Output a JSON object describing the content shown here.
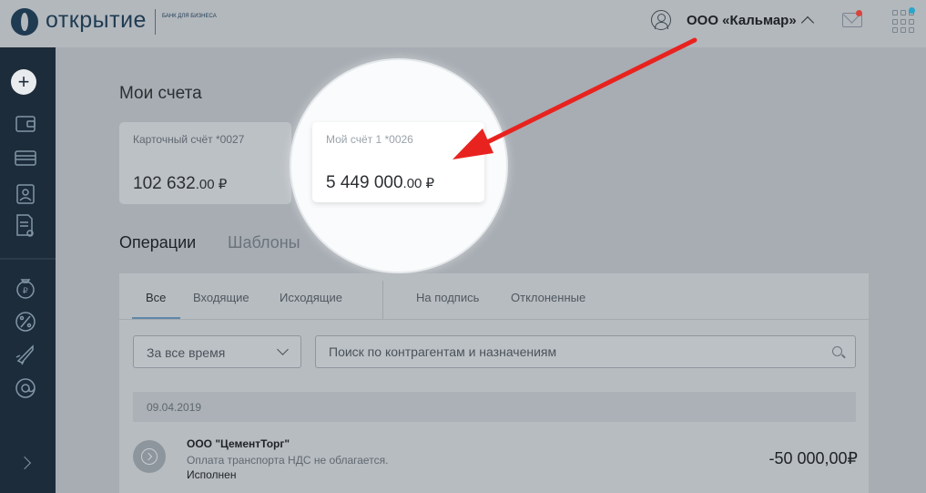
{
  "brand": {
    "name": "открытие",
    "subtitle": "банк для бизнеса"
  },
  "header": {
    "company": "ООО «Кальмар»"
  },
  "page": {
    "title": "Мои счета"
  },
  "accounts": [
    {
      "name": "Карточный счёт *0027",
      "balance_int": "102 632",
      "balance_dec": ".00 ₽"
    },
    {
      "name": "Мой счёт 1 *0026",
      "balance_int": "5 449 000",
      "balance_dec": ".00 ₽"
    }
  ],
  "tabs": {
    "operations": "Операции",
    "templates": "Шаблоны"
  },
  "filters": {
    "all": "Все",
    "incoming": "Входящие",
    "outgoing": "Исходящие",
    "to_sign": "На подпись",
    "rejected": "Отклоненные"
  },
  "period": {
    "selected": "За все время"
  },
  "search": {
    "placeholder": "Поиск по контрагентам и назначениям"
  },
  "operations": [
    {
      "date": "09.04.2019",
      "counterparty": "ООО \"ЦементТорг\"",
      "purpose": "Оплата транспорта НДС не облагается.",
      "status": "Исполнен",
      "amount": "-50 000,00₽"
    }
  ],
  "colors": {
    "arrow": "#e8231f",
    "sidebar": "#1d2c3a",
    "accent": "#5f87a8"
  }
}
